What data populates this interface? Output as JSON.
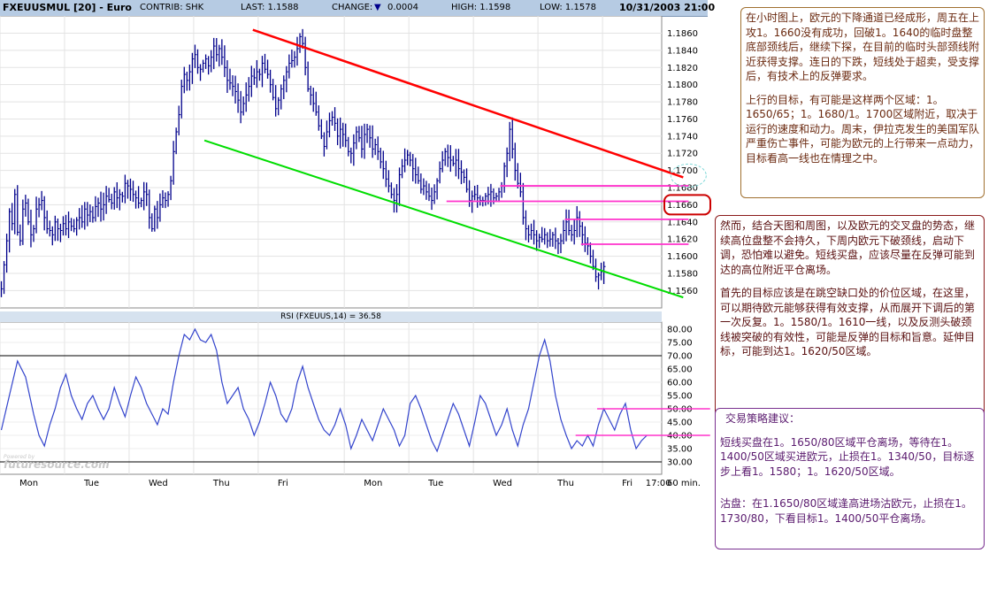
{
  "header": {
    "symbol": "FXEUUSMUL [20] - Euro",
    "contrib": "CONTRIB: SHK",
    "last": "LAST: 1.1588",
    "change_label": "CHANGE:",
    "change_arrow": "▼",
    "change_value": "0.0004",
    "high": "HIGH: 1.1598",
    "low": "LOW: 1.1578",
    "datetime": "10/31/2003 21:00"
  },
  "rsi_title": "RSI (FXEUUS,14) = 36.58",
  "watermark": {
    "small": "Powered by",
    "text": "futuresource.com"
  },
  "colors": {
    "price": "#00008b",
    "rsi": "#3344cc",
    "resistance": "#ff0000",
    "support": "#00dd00",
    "level_lines": "#ff33cc",
    "header_bg": "#b6cbe3"
  },
  "notes": {
    "n1": {
      "p1": "在小时图上，欧元的下降通道已经成形，周五在上攻1。1660没有成功，回破1。1640的临时盘整底部颈线后，继续下探，在目前的临时头部颈线附近获得支撑。连日的下跌，短线处于超卖，受支撑后，有技术上的反弹要求。",
      "p2": "上行的目标，有可能是这样两个区域：1。1650/65；1。1680/1。1700区域附近，取决于运行的速度和动力。周末，伊拉克发生的美国军队严重伤亡事件，可能为欧元的上行带来一点动力，目标看高一线也在情理之中。"
    },
    "n2": {
      "p1": "然而，结合天图和周图，以及欧元的交叉盘的势态，继续高位盘整不会持久，下周内欧元下破颈线，启动下调，恐怕难以避免。短线买盘，应该尽量在反弹可能到达的高位附近平仓离场。",
      "p2": "首先的目标应该是在跳空缺口处的价位区域，在这里，可以期待欧元能够获得有效支撑，从而展开下调后的第一次反复。1。1580/1。1610一线，以及反测头破颈线被突破的有效性，可能是反弹的目标和旨意。延伸目标，可能到达1。1620/50区域。"
    },
    "n3": {
      "title": "交易策略建议：",
      "p1": "短线买盘在1。1650/80区域平仓离场，等待在1。1400/50区域买进欧元，止损在1。1340/50，目标逐步上看1。1580；1。1620/50区域。",
      "p2": "沽盘：在1.1650/80区域逢高进场沽欧元，止损在1。1730/80，下看目标1。1400/50平仓离场。"
    }
  },
  "chart_data": [
    {
      "type": "ohlc",
      "series_name": "FXEUUSMUL",
      "y_ticks": [
        1.156,
        1.158,
        1.16,
        1.162,
        1.164,
        1.166,
        1.168,
        1.17,
        1.172,
        1.174,
        1.176,
        1.178,
        1.18,
        1.182,
        1.184,
        1.186
      ],
      "x_labels": [
        "Mon",
        "Tue",
        "Wed",
        "Thu",
        "Fri",
        "Mon",
        "Tue",
        "Wed",
        "Thu",
        "Fri",
        "17:00"
      ],
      "x_label_positions": [
        0,
        24,
        48,
        72,
        96,
        128,
        152,
        176,
        200,
        224,
        240
      ],
      "ylim": [
        1.1548,
        1.1876
      ],
      "x_range": [
        0,
        246
      ],
      "closes": [
        1.1562,
        1.159,
        1.1618,
        1.1652,
        1.1638,
        1.1672,
        1.1628,
        1.1618,
        1.1655,
        1.1662,
        1.164,
        1.1625,
        1.1632,
        1.1655,
        1.166,
        1.1665,
        1.1645,
        1.1632,
        1.163,
        1.1625,
        1.164,
        1.1632,
        1.163,
        1.1638,
        1.1632,
        1.164,
        1.1635,
        1.1632,
        1.1642,
        1.1645,
        1.164,
        1.1655,
        1.1648,
        1.1652,
        1.1645,
        1.1658,
        1.1662,
        1.1655,
        1.166,
        1.167,
        1.1666,
        1.1662,
        1.1675,
        1.1668,
        1.1672,
        1.167,
        1.1685,
        1.1682,
        1.1678,
        1.1672,
        1.1668,
        1.1662,
        1.1665,
        1.1675,
        1.1672,
        1.1645,
        1.1632,
        1.1655,
        1.1645,
        1.166,
        1.1668,
        1.1665,
        1.1672,
        1.1688,
        1.1722,
        1.1745,
        1.1765,
        1.1798,
        1.1812,
        1.1805,
        1.1815,
        1.183,
        1.1835,
        1.182,
        1.1818,
        1.1825,
        1.183,
        1.1822,
        1.1832,
        1.1845,
        1.1835,
        1.1842,
        1.1832,
        1.182,
        1.1805,
        1.1802,
        1.1798,
        1.1792,
        1.1782,
        1.1768,
        1.1778,
        1.1788,
        1.1798,
        1.181,
        1.1808,
        1.1815,
        1.1812,
        1.1825,
        1.1818,
        1.1812,
        1.18,
        1.1785,
        1.1772,
        1.1782,
        1.1795,
        1.1805,
        1.1815,
        1.1825,
        1.1828,
        1.1832,
        1.1842,
        1.1856,
        1.1848,
        1.182,
        1.1795,
        1.1788,
        1.1778,
        1.1768,
        1.1752,
        1.174,
        1.1728,
        1.1745,
        1.1758,
        1.1762,
        1.1755,
        1.174,
        1.1748,
        1.1742,
        1.1735,
        1.1722,
        1.172,
        1.1732,
        1.1745,
        1.1738,
        1.1725,
        1.1742,
        1.1748,
        1.1738,
        1.1725,
        1.173,
        1.1722,
        1.171,
        1.1702,
        1.169,
        1.1682,
        1.1672,
        1.1665,
        1.1672,
        1.1695,
        1.1705,
        1.1712,
        1.1718,
        1.1712,
        1.1702,
        1.1695,
        1.1688,
        1.1678,
        1.1682,
        1.1675,
        1.167,
        1.1665,
        1.1675,
        1.1688,
        1.1702,
        1.1712,
        1.1722,
        1.1715,
        1.1712,
        1.1708,
        1.1712,
        1.1702,
        1.1698,
        1.1692,
        1.1678,
        1.1665,
        1.167,
        1.1672,
        1.1668,
        1.1665,
        1.1665,
        1.167,
        1.1672,
        1.1675,
        1.1668,
        1.167,
        1.1675,
        1.1682,
        1.1705,
        1.172,
        1.1748,
        1.1725,
        1.17,
        1.1685,
        1.1675,
        1.1645,
        1.1632,
        1.1625,
        1.163,
        1.1625,
        1.1618,
        1.1622,
        1.162,
        1.1625,
        1.1618,
        1.162,
        1.1625,
        1.1618,
        1.1615,
        1.1618,
        1.163,
        1.164,
        1.163,
        1.1625,
        1.163,
        1.1645,
        1.1635,
        1.1625,
        1.1615,
        1.1612,
        1.16,
        1.1588,
        1.1576,
        1.1578,
        1.1582,
        1.1588
      ]
    },
    {
      "type": "line",
      "series_name": "RSI (FXEUUS,14)",
      "y_ticks": [
        30,
        35,
        40,
        45,
        50,
        55,
        60,
        65,
        70,
        75,
        80
      ],
      "ylim": [
        28,
        82
      ],
      "reference_lines": [
        70,
        30
      ],
      "points": [
        [
          0,
          42
        ],
        [
          3,
          55
        ],
        [
          6,
          68
        ],
        [
          9,
          62
        ],
        [
          12,
          48
        ],
        [
          14,
          40
        ],
        [
          16,
          36
        ],
        [
          18,
          44
        ],
        [
          20,
          50
        ],
        [
          22,
          58
        ],
        [
          24,
          63
        ],
        [
          26,
          55
        ],
        [
          28,
          50
        ],
        [
          30,
          46
        ],
        [
          32,
          52
        ],
        [
          34,
          55
        ],
        [
          36,
          50
        ],
        [
          38,
          46
        ],
        [
          40,
          50
        ],
        [
          42,
          58
        ],
        [
          44,
          52
        ],
        [
          46,
          47
        ],
        [
          48,
          55
        ],
        [
          50,
          62
        ],
        [
          52,
          58
        ],
        [
          54,
          52
        ],
        [
          56,
          48
        ],
        [
          58,
          44
        ],
        [
          60,
          50
        ],
        [
          62,
          48
        ],
        [
          64,
          60
        ],
        [
          66,
          70
        ],
        [
          68,
          78
        ],
        [
          70,
          76
        ],
        [
          72,
          80
        ],
        [
          74,
          76
        ],
        [
          76,
          75
        ],
        [
          78,
          78
        ],
        [
          80,
          72
        ],
        [
          82,
          60
        ],
        [
          84,
          52
        ],
        [
          86,
          55
        ],
        [
          88,
          58
        ],
        [
          90,
          50
        ],
        [
          92,
          46
        ],
        [
          94,
          40
        ],
        [
          96,
          45
        ],
        [
          98,
          52
        ],
        [
          100,
          60
        ],
        [
          102,
          55
        ],
        [
          104,
          48
        ],
        [
          106,
          45
        ],
        [
          108,
          50
        ],
        [
          110,
          60
        ],
        [
          112,
          66
        ],
        [
          114,
          58
        ],
        [
          116,
          52
        ],
        [
          118,
          46
        ],
        [
          120,
          42
        ],
        [
          122,
          40
        ],
        [
          124,
          44
        ],
        [
          126,
          50
        ],
        [
          128,
          44
        ],
        [
          130,
          35
        ],
        [
          132,
          40
        ],
        [
          134,
          46
        ],
        [
          136,
          42
        ],
        [
          138,
          38
        ],
        [
          140,
          44
        ],
        [
          142,
          50
        ],
        [
          144,
          46
        ],
        [
          146,
          42
        ],
        [
          148,
          36
        ],
        [
          150,
          40
        ],
        [
          152,
          52
        ],
        [
          154,
          55
        ],
        [
          156,
          50
        ],
        [
          158,
          44
        ],
        [
          160,
          38
        ],
        [
          162,
          34
        ],
        [
          164,
          40
        ],
        [
          166,
          46
        ],
        [
          168,
          52
        ],
        [
          170,
          48
        ],
        [
          172,
          42
        ],
        [
          174,
          36
        ],
        [
          176,
          45
        ],
        [
          178,
          55
        ],
        [
          180,
          52
        ],
        [
          182,
          46
        ],
        [
          184,
          40
        ],
        [
          186,
          44
        ],
        [
          188,
          50
        ],
        [
          190,
          42
        ],
        [
          192,
          36
        ],
        [
          194,
          44
        ],
        [
          196,
          50
        ],
        [
          198,
          60
        ],
        [
          200,
          70
        ],
        [
          202,
          76
        ],
        [
          204,
          68
        ],
        [
          206,
          55
        ],
        [
          208,
          46
        ],
        [
          210,
          40
        ],
        [
          212,
          35
        ],
        [
          214,
          38
        ],
        [
          216,
          36
        ],
        [
          218,
          40
        ],
        [
          220,
          36
        ],
        [
          222,
          44
        ],
        [
          224,
          50
        ],
        [
          226,
          46
        ],
        [
          228,
          42
        ],
        [
          230,
          48
        ],
        [
          232,
          52
        ],
        [
          234,
          42
        ],
        [
          236,
          35
        ],
        [
          238,
          38
        ],
        [
          240,
          40
        ]
      ]
    }
  ],
  "annotations": {
    "resistance_line": {
      "from": [
        94,
        1.1864
      ],
      "to": [
        254,
        1.1692
      ]
    },
    "support_line": {
      "from": [
        76,
        1.1735
      ],
      "to": [
        254,
        1.1552
      ]
    },
    "levels": [
      {
        "price": 1.1682,
        "from": 186,
        "to": 256
      },
      {
        "price": 1.1664,
        "from": 166,
        "to": 256
      },
      {
        "price": 1.1643,
        "from": 210,
        "to": 256
      },
      {
        "price": 1.1614,
        "from": 216,
        "to": 256
      }
    ],
    "rsi_levels": [
      {
        "value": 50,
        "from": 222,
        "to": 264
      },
      {
        "value": 40,
        "from": 214,
        "to": 264
      }
    ],
    "target_price_circle": 1.166,
    "x_axis_extra": "60 min."
  }
}
